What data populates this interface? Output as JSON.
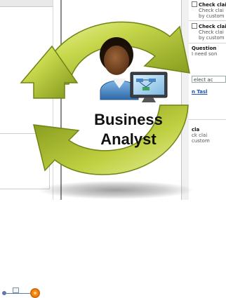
{
  "tasks": [
    {
      "title": "Check clai",
      "sub1": "Check clai",
      "sub2": "by custom"
    },
    {
      "title": "Check clai",
      "sub1": "Check clai",
      "sub2": "by custom"
    },
    {
      "title": "Question",
      "sub1": "I need son",
      "sub2": ""
    }
  ],
  "select_placeholder": "elect ac",
  "task_link": "n Tasl",
  "task_bottom": {
    "title": "cla",
    "sub1": "ck clai",
    "sub2": "custom"
  },
  "overlay": {
    "title_line1": "Business",
    "title_line2": "Analyst",
    "arrow_color": "#b5c93a",
    "skin_color": "#7a4a28",
    "shirt_color": "#4a89c8"
  },
  "icons": [
    "recycle-arrows-icon",
    "person-icon",
    "monitor-flowchart-icon"
  ]
}
